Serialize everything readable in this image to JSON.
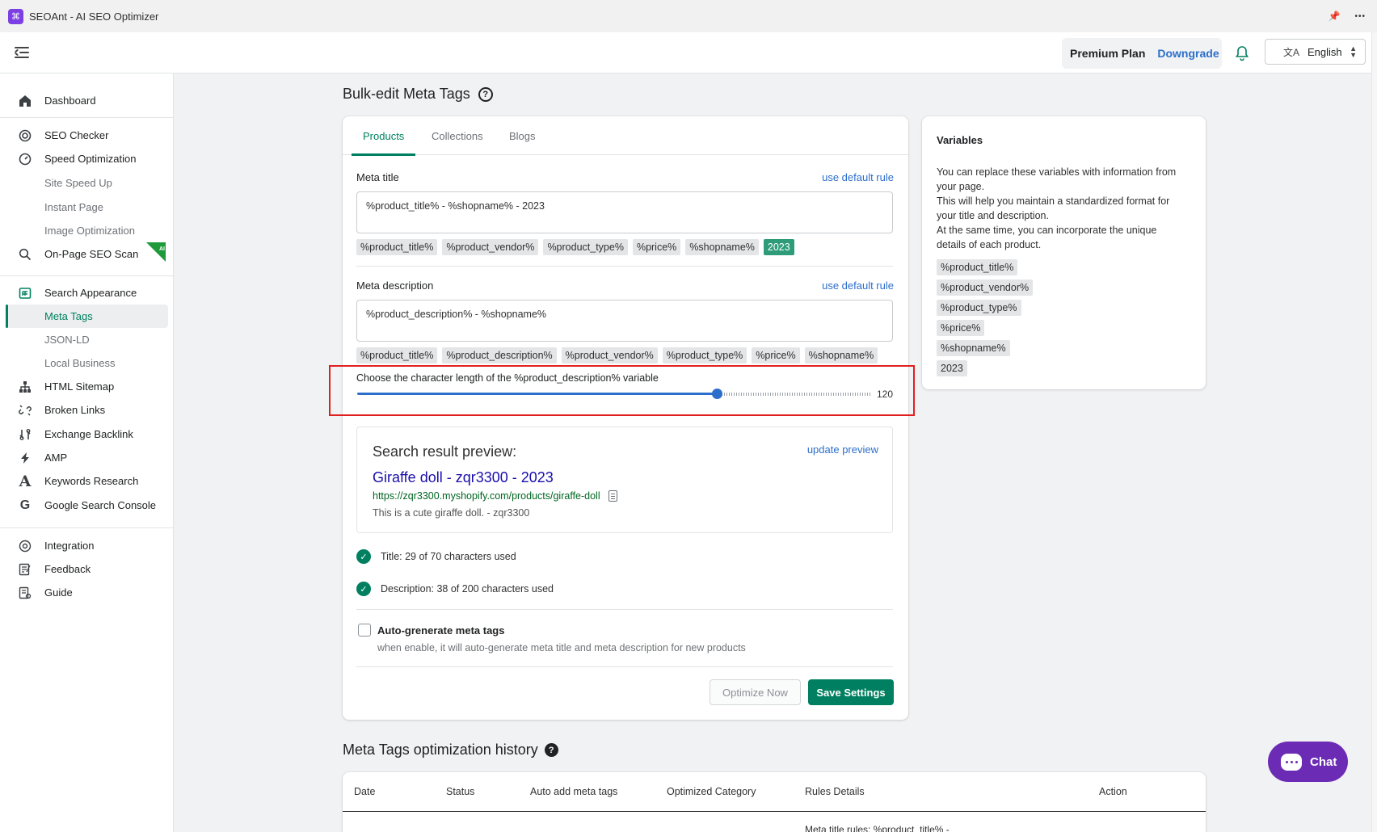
{
  "window": {
    "title": "SEOAnt - AI SEO Optimizer",
    "logo_glyph": "⌘",
    "pin_icon": "📌",
    "more_icon": "•••"
  },
  "header": {
    "plan_name": "Premium Plan",
    "plan_action": "Downgrade",
    "language": "English",
    "language_icon": "文A"
  },
  "sidebar": {
    "items": [
      {
        "label": "Dashboard",
        "icon": "home-icon"
      },
      {
        "label": "SEO Checker",
        "icon": "target-icon"
      },
      {
        "label": "Speed Optimization",
        "icon": "speedometer-icon"
      },
      {
        "label": "Site Speed Up",
        "icon": ""
      },
      {
        "label": "Instant Page",
        "icon": ""
      },
      {
        "label": "Image Optimization",
        "icon": ""
      },
      {
        "label": "On-Page SEO Scan",
        "icon": "search-icon",
        "badge": "AI"
      },
      {
        "label": "Search Appearance",
        "icon": "grid-icon"
      },
      {
        "label": "Meta Tags",
        "icon": ""
      },
      {
        "label": "JSON-LD",
        "icon": ""
      },
      {
        "label": "Local Business",
        "icon": ""
      },
      {
        "label": "HTML Sitemap",
        "icon": "sitemap-icon"
      },
      {
        "label": "Broken Links",
        "icon": "broken-link-icon"
      },
      {
        "label": "Exchange Backlink",
        "icon": "exchange-icon"
      },
      {
        "label": "AMP",
        "icon": "lightning-icon"
      },
      {
        "label": "Keywords Research",
        "icon": "letter-a-icon"
      },
      {
        "label": "Google Search Console",
        "icon": "google-icon"
      },
      {
        "label": "Integration",
        "icon": "integration-icon"
      },
      {
        "label": "Feedback",
        "icon": "feedback-icon"
      },
      {
        "label": "Guide",
        "icon": "guide-icon"
      }
    ],
    "active_item": "Meta Tags"
  },
  "page": {
    "title": "Bulk-edit Meta Tags",
    "tabs": [
      "Products",
      "Collections",
      "Blogs"
    ],
    "active_tab": "Products",
    "meta_title": {
      "label": "Meta title",
      "link": "use default rule",
      "value": "%product_title% - %shopname% - 2023",
      "chips": [
        "%product_title%",
        "%product_vendor%",
        "%product_type%",
        "%price%",
        "%shopname%",
        "2023"
      ],
      "active_chip": "2023"
    },
    "meta_description": {
      "label": "Meta description",
      "link": "use default rule",
      "value": "%product_description% - %shopname%",
      "chips": [
        "%product_title%",
        "%product_description%",
        "%product_vendor%",
        "%product_type%",
        "%price%",
        "%shopname%"
      ]
    },
    "slider": {
      "label": "Choose the character length of the %product_description% variable",
      "value": 120,
      "value_text": "120",
      "fill_fraction": 0.7
    },
    "preview": {
      "heading": "Search result preview:",
      "update_link": "update preview",
      "title": "Giraffe doll - zqr3300 - 2023",
      "url": "https://zqr3300.myshopify.com/products/giraffe-doll",
      "description": "This is a cute giraffe doll. - zqr3300"
    },
    "checks": [
      "Title: 29 of 70 characters used",
      "Description: 38 of 200 characters used"
    ],
    "auto_generate": {
      "label": "Auto-grenerate meta tags",
      "help": "when enable, it will auto-generate meta title and meta description for new products",
      "checked": false
    },
    "buttons": {
      "secondary": "Optimize Now",
      "primary": "Save Settings"
    }
  },
  "variables": {
    "title": "Variables",
    "description_lines": [
      "You can replace these variables with information from your page.",
      "This will help you maintain a standardized format for your title and description.",
      "At the same time, you can incorporate the unique details of each product."
    ],
    "items": [
      "%product_title%",
      "%product_vendor%",
      "%product_type%",
      "%price%",
      "%shopname%",
      "2023"
    ]
  },
  "history": {
    "title": "Meta Tags optimization history",
    "columns": [
      "Date",
      "Status",
      "Auto add meta tags",
      "Optimized Category",
      "Rules Details",
      "Action"
    ],
    "partial_row_text": "Meta title rules: %product_title% -"
  },
  "chat": {
    "label": "Chat"
  },
  "colors": {
    "accent": "#008060",
    "link": "#2c6ecb",
    "chat": "#6c2bb5",
    "highlight": "#e02020"
  }
}
